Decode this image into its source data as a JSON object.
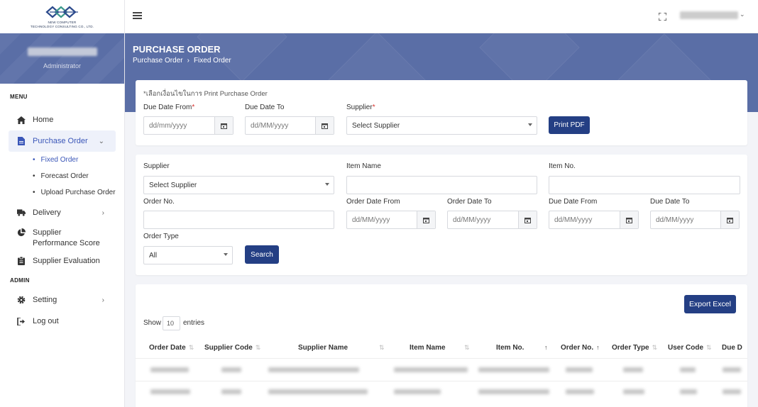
{
  "brand": {
    "line1": "NEW COMPUTER",
    "line2": "TECHNOLOGY CONSULTING CO., LTD."
  },
  "profile": {
    "role": "Administrator"
  },
  "sidebar": {
    "menu_heading": "MENU",
    "admin_heading": "ADMIN",
    "items": {
      "home": "Home",
      "purchase_order": "Purchase Order",
      "fixed_order": "Fixed Order",
      "forecast_order": "Forecast Order",
      "upload_po": "Upload Purchase Order",
      "delivery": "Delivery",
      "supplier_performance": "Supplier Performance Score",
      "supplier_evaluation": "Supplier Evaluation",
      "setting": "Setting",
      "logout": "Log out"
    }
  },
  "header": {
    "title": "PURCHASE ORDER",
    "breadcrumb": [
      "Purchase Order",
      "Fixed Order"
    ]
  },
  "print_form": {
    "note": "*เลือกเงื่อนไขในการ Print Purchase Order",
    "due_from_label": "Due Date From",
    "due_to_label": "Due Date To",
    "supplier_label": "Supplier",
    "due_from_placeholder": "dd/mm/yyyy",
    "due_to_placeholder": "dd/MM/yyyy",
    "supplier_value": "Select Supplier",
    "print_button": "Print PDF"
  },
  "search_form": {
    "supplier_label": "Supplier",
    "supplier_value": "Select Supplier",
    "item_name_label": "Item Name",
    "item_no_label": "Item No.",
    "order_no_label": "Order No.",
    "order_date_from_label": "Order Date From",
    "order_date_to_label": "Order Date To",
    "due_date_from_label": "Due Date From",
    "due_date_to_label": "Due Date To",
    "date_placeholder": "dd/MM/yyyy",
    "order_type_label": "Order Type",
    "order_type_value": "All",
    "search_button": "Search"
  },
  "table": {
    "export_button": "Export Excel",
    "show_label": "Show",
    "entries_value": "10",
    "entries_label": "entries",
    "columns": [
      "Order Date",
      "Supplier Code",
      "Supplier Name",
      "Item Name",
      "Item No.",
      "Order No.",
      "Order Type",
      "User Code",
      "Due D"
    ]
  },
  "colors": {
    "banner": "#5a6ea6",
    "primary_button": "#243f84",
    "active_nav": "#3a56b8",
    "required": "#d9302c"
  }
}
